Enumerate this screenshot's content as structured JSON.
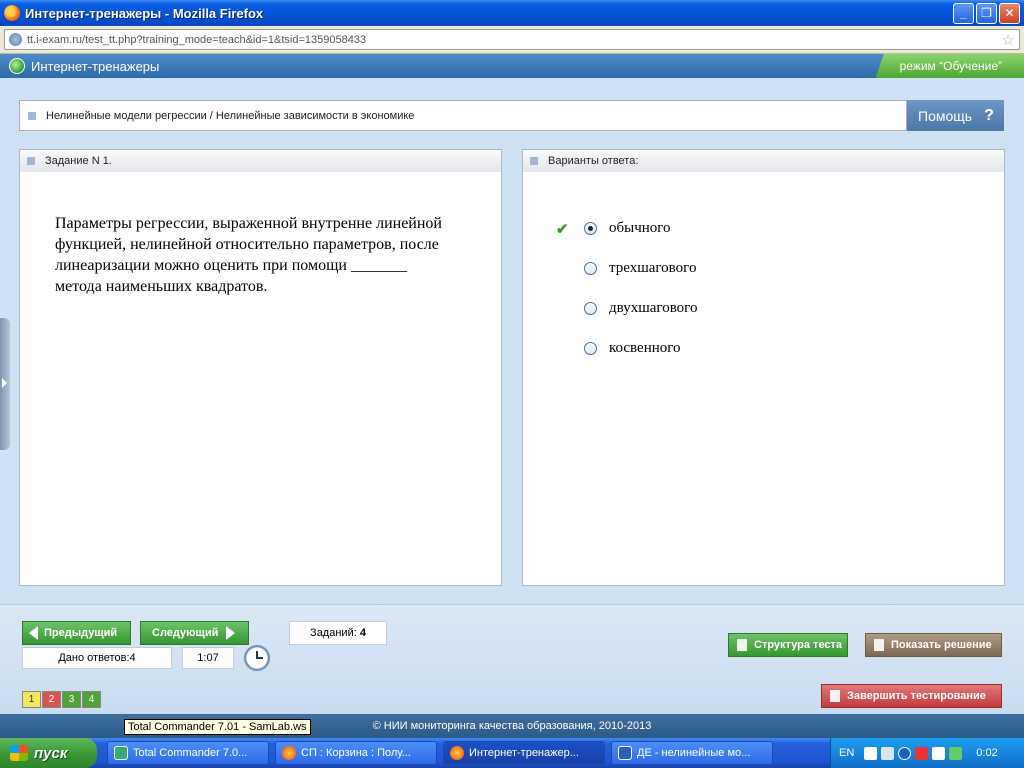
{
  "window": {
    "title": "Интернет-тренажеры - Mozilla Firefox"
  },
  "browser": {
    "url": "tt.i-exam.ru/test_tt.php?training_mode=teach&id=1&tsid=1359058433"
  },
  "app": {
    "title": "Интернет-тренажеры",
    "mode": "режим “Обучение”"
  },
  "breadcrumb": {
    "text": "Нелинейные модели регрессии / Нелинейные зависимости в экономике"
  },
  "help": {
    "label": "Помощь",
    "icon": "?"
  },
  "task": {
    "header": "Задание N 1.",
    "text": "Параметры регрессии, выраженной внутренне линейной функцией, нелинейной относительно параметров, после линеаризации можно оценить при помощи _______ метода наименьших квадратов."
  },
  "answers": {
    "header": "Варианты ответа:",
    "options": [
      {
        "label": "обычного",
        "selected": true
      },
      {
        "label": "трехшагового",
        "selected": false
      },
      {
        "label": "двухшагового",
        "selected": false
      },
      {
        "label": "косвенного",
        "selected": false
      }
    ]
  },
  "nav": {
    "prev_label": "Предыдущий",
    "next_label": "Следующий",
    "tasks_label": "Заданий:",
    "tasks_count": "4",
    "answered_label": "Дано ответов:4",
    "timer": "1:07"
  },
  "actions": {
    "structure_label": "Структура теста",
    "solution_label": "Показать решение",
    "finish_label": "Завершить тестирование"
  },
  "pages": [
    "1",
    "2",
    "3",
    "4"
  ],
  "footer": {
    "copyright": "© НИИ мониторинга качества образования, 2010-2013"
  },
  "tooltip": {
    "text": "Total Commander 7.01 - SamLab.ws"
  },
  "taskbar": {
    "start_label": "пуск",
    "tasks": [
      {
        "label": "Total Commander 7.0...",
        "icon": "total-commander-icon",
        "active": false
      },
      {
        "label": "СП : Корзина : Полу...",
        "icon": "firefox-icon",
        "active": false
      },
      {
        "label": "Интернет-тренажер...",
        "icon": "firefox-icon",
        "active": true
      },
      {
        "label": "ДЕ - нелинейные мо...",
        "icon": "word-icon",
        "active": false
      }
    ],
    "lang": "EN",
    "time": "0:02"
  }
}
